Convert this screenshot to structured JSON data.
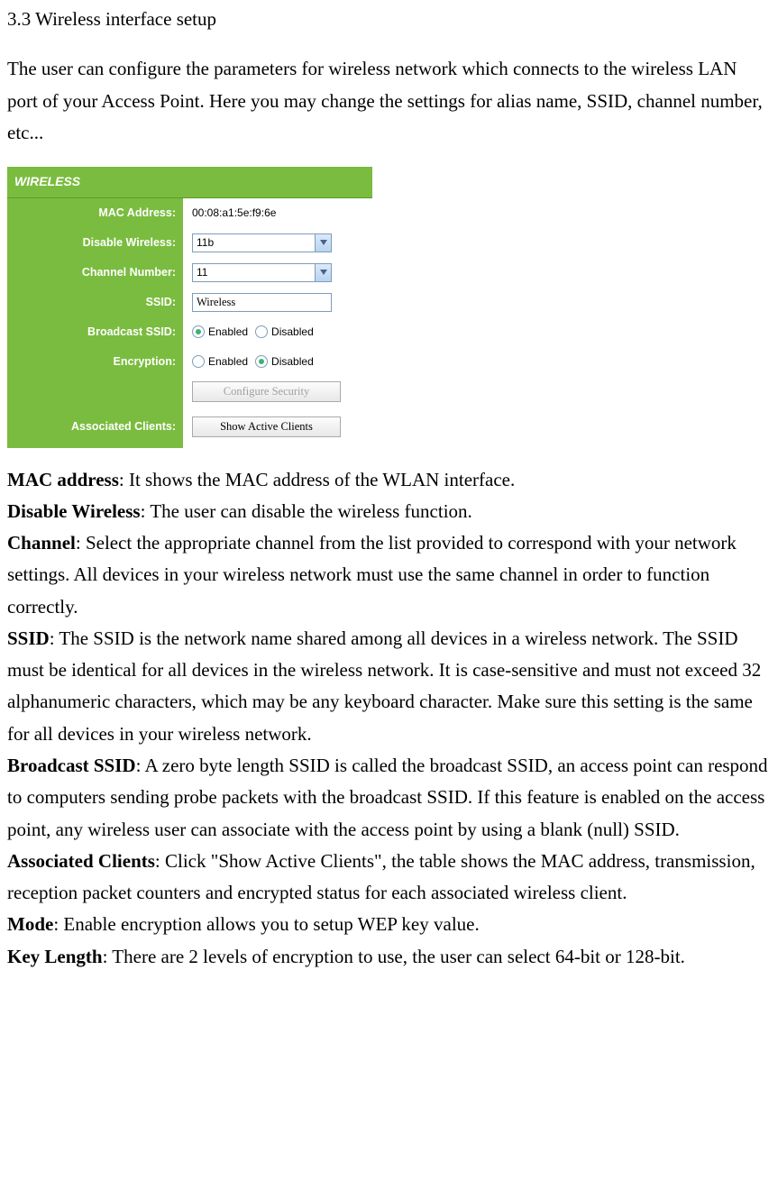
{
  "heading": "3.3 Wireless interface setup",
  "intro": "The user can configure the parameters for wireless network which connects to the wireless LAN port of your Access Point. Here you may change the settings for alias name, SSID, channel number, etc...",
  "panel": {
    "title": "WIRELESS",
    "rows": {
      "mac": {
        "label": "MAC Address:",
        "value": "00:08:a1:5e:f9:6e"
      },
      "disable": {
        "label": "Disable Wireless:",
        "selected": "11b"
      },
      "channel": {
        "label": "Channel Number:",
        "selected": "11"
      },
      "ssid": {
        "label": "SSID:",
        "value": "Wireless"
      },
      "broadcast": {
        "label": "Broadcast SSID:",
        "opt1": "Enabled",
        "opt2": "Disabled",
        "selected": "Enabled"
      },
      "encryption": {
        "label": "Encryption:",
        "opt1": "Enabled",
        "opt2": "Disabled",
        "selected": "Disabled"
      },
      "configure": {
        "label": "",
        "button": "Configure   Security"
      },
      "clients": {
        "label": "Associated Clients:",
        "button": "Show Active Clients"
      }
    }
  },
  "descriptions": [
    {
      "term": "MAC address",
      "text": ": It shows the MAC address of the WLAN interface."
    },
    {
      "term": "Disable Wireless",
      "text": ": The user can disable the wireless function."
    },
    {
      "term": "Channel",
      "text": ": Select the appropriate channel from the list provided to correspond with your network settings. All devices in your wireless network must use the same channel in order to function correctly."
    },
    {
      "term": "SSID",
      "text": ": The SSID is the network name shared among all devices in a wireless network. The SSID must be identical for all devices in the wireless network. It is case-sensitive and must not exceed 32 alphanumeric characters, which may be any keyboard character. Make sure this setting is the same for all devices in your wireless network."
    },
    {
      "term": "Broadcast SSID",
      "text": ": A zero byte length SSID is called the broadcast SSID, an access point can respond to computers sending probe packets with the broadcast SSID. If this feature is enabled on the access point, any wireless user can associate with the access point by using a blank (null) SSID."
    },
    {
      "term": "Associated Clients",
      "text": ": Click \"Show Active Clients\", the table shows the MAC address, transmission, reception packet counters and encrypted status for each associated wireless client."
    },
    {
      "term": "Mode",
      "text": ": Enable encryption allows you to setup WEP key value."
    },
    {
      "term": "Key Length",
      "text": ": There are 2 levels of encryption to use, the user can select 64-bit or 128-bit."
    }
  ]
}
